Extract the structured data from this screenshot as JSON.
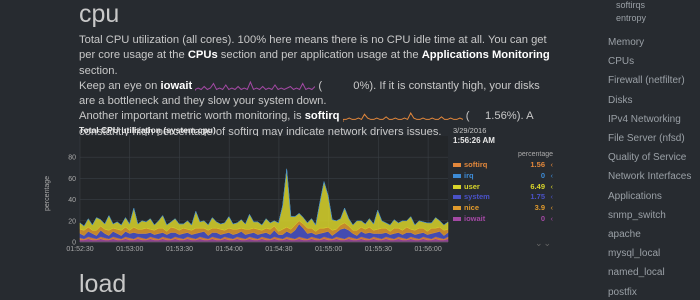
{
  "page": {
    "section_title": "cpu",
    "next_section_title": "load",
    "description": {
      "part1": "Total CPU utilization (all cores). 100% here means there is no CPU idle time at all. You can get per core usage at the ",
      "link_cpus": "CPUs",
      "part2": " section and per application usage at the ",
      "link_apps": "Applications Monitoring",
      "part3": " section.",
      "part4": "Keep an eye on ",
      "dim_iowait": "iowait",
      "iowait_value": "0%",
      "part5": ". If it is constantly high, your disks are a bottleneck and they slow your system down.",
      "part6": "Another important metric worth monitoring, is ",
      "dim_softirq": "softirq",
      "softirq_value": "1.56%",
      "part7": ". A constantly high percentage of softirq may indicate network drivers issues."
    }
  },
  "sidebar": {
    "top_items": [
      "softirqs",
      "entropy"
    ],
    "items": [
      "Memory",
      "CPUs",
      "Firewall (netfilter)",
      "Disks",
      "IPv4 Networking",
      "File Server (nfsd)",
      "Quality of Service",
      "Network Interfaces",
      "Applications",
      "snmp_switch",
      "apache",
      "mysql_local",
      "named_local",
      "postfix"
    ]
  },
  "chart": {
    "title": "Total CPU utilization (system.cpu)",
    "units_vertical": "percentage",
    "legend_units": "percentage",
    "date": "3/29/2016",
    "time": "1:56:26 AM",
    "dimensions": [
      {
        "name": "softirq",
        "value": "1.56",
        "color": "#e2873b"
      },
      {
        "name": "irq",
        "value": "0",
        "color": "#3d8bd6"
      },
      {
        "name": "user",
        "value": "6.49",
        "color": "#d8d42a"
      },
      {
        "name": "system",
        "value": "1.75",
        "color": "#4a52c8"
      },
      {
        "name": "nice",
        "value": "3.9",
        "color": "#e09a2d"
      },
      {
        "name": "iowait",
        "value": "0",
        "color": "#a349a4"
      }
    ],
    "resize_glyph": "⌄⌄"
  },
  "chart_data": {
    "type": "area",
    "title": "Total CPU utilization (system.cpu)",
    "ylabel": "percentage",
    "ylim": [
      0,
      100
    ],
    "yticks": [
      0,
      20,
      40,
      60,
      80
    ],
    "x_tick_labels": [
      "01:52:30",
      "01:53:00",
      "01:53:30",
      "01:54:00",
      "01:54:30",
      "01:55:00",
      "01:55:30",
      "01:56:00"
    ],
    "grid": true,
    "series": [
      {
        "name": "iowait",
        "color": "#a349a4",
        "values": [
          2,
          2,
          3,
          2,
          2,
          3,
          2,
          2,
          3,
          2,
          2,
          3,
          2,
          2,
          3,
          2,
          2,
          3,
          2,
          2,
          3,
          2,
          2,
          3,
          2,
          2,
          3,
          2,
          2,
          3,
          2,
          2,
          3,
          2,
          2,
          3,
          2,
          2,
          3,
          2,
          2,
          3,
          2,
          2,
          3,
          2,
          2,
          3,
          2,
          2,
          3,
          2,
          2,
          3,
          2,
          2,
          3,
          2,
          2,
          3,
          2,
          2,
          3,
          2,
          2,
          3,
          2,
          2,
          3,
          2,
          2,
          3,
          2,
          2,
          3,
          2,
          2,
          3,
          2,
          2,
          3,
          2,
          2,
          3,
          2,
          2,
          3,
          2,
          2,
          3
        ]
      },
      {
        "name": "softirq",
        "color": "#e2873b",
        "values": [
          2,
          1,
          2,
          2,
          1,
          2,
          2,
          1,
          2,
          2,
          1,
          2,
          2,
          1,
          2,
          2,
          1,
          2,
          2,
          1,
          2,
          2,
          1,
          2,
          2,
          1,
          2,
          2,
          1,
          2,
          2,
          1,
          2,
          2,
          1,
          2,
          2,
          1,
          2,
          2,
          1,
          2,
          2,
          1,
          2,
          2,
          1,
          2,
          2,
          1,
          2,
          2,
          1,
          2,
          2,
          1,
          2,
          2,
          1,
          2,
          2,
          1,
          2,
          2,
          1,
          2,
          2,
          1,
          2,
          2,
          1,
          2,
          2,
          1,
          2,
          2,
          1,
          2,
          2,
          1,
          2,
          2,
          1,
          2,
          2,
          1,
          2,
          2,
          1,
          2
        ]
      },
      {
        "name": "system",
        "color": "#4a52c8",
        "values": [
          4,
          3,
          5,
          4,
          3,
          6,
          4,
          3,
          5,
          4,
          3,
          5,
          4,
          6,
          3,
          4,
          5,
          4,
          3,
          5,
          4,
          3,
          6,
          4,
          3,
          5,
          4,
          3,
          5,
          4,
          6,
          3,
          4,
          5,
          4,
          3,
          5,
          4,
          3,
          6,
          4,
          3,
          5,
          4,
          3,
          5,
          4,
          6,
          3,
          4,
          5,
          4,
          8,
          12,
          9,
          5,
          4,
          3,
          5,
          4,
          6,
          3,
          4,
          8,
          10,
          6,
          4,
          3,
          5,
          4,
          6,
          3,
          4,
          5,
          4,
          3,
          5,
          4,
          3,
          6,
          4,
          3,
          5,
          4,
          3,
          5,
          4,
          6,
          3,
          4
        ]
      },
      {
        "name": "nice",
        "color": "#e09a2d",
        "values": [
          4,
          5,
          4,
          3,
          5,
          4,
          4,
          5,
          3,
          4,
          5,
          4,
          3,
          5,
          4,
          4,
          5,
          3,
          4,
          5,
          4,
          3,
          5,
          4,
          4,
          5,
          3,
          4,
          5,
          4,
          3,
          5,
          4,
          4,
          5,
          3,
          4,
          5,
          4,
          3,
          5,
          4,
          4,
          5,
          3,
          4,
          5,
          4,
          3,
          5,
          4,
          4,
          5,
          3,
          4,
          5,
          4,
          3,
          5,
          4,
          4,
          5,
          3,
          4,
          5,
          4,
          3,
          5,
          4,
          4,
          5,
          3,
          4,
          5,
          4,
          3,
          5,
          4,
          4,
          5,
          3,
          4,
          5,
          4,
          3,
          5,
          4,
          4,
          5,
          3
        ]
      },
      {
        "name": "user",
        "color": "#d8d42a",
        "values": [
          6,
          4,
          8,
          5,
          12,
          6,
          5,
          14,
          4,
          7,
          5,
          9,
          6,
          18,
          5,
          8,
          6,
          10,
          5,
          7,
          12,
          6,
          5,
          9,
          6,
          4,
          8,
          5,
          16,
          6,
          7,
          5,
          10,
          6,
          5,
          7,
          11,
          5,
          6,
          8,
          5,
          14,
          6,
          7,
          5,
          9,
          6,
          5,
          8,
          22,
          55,
          12,
          8,
          7,
          6,
          5,
          9,
          6,
          24,
          44,
          30,
          10,
          8,
          6,
          14,
          7,
          5,
          9,
          6,
          5,
          8,
          6,
          18,
          7,
          5,
          6,
          8,
          5,
          9,
          6,
          12,
          5,
          7,
          6,
          8,
          5,
          10,
          6,
          5,
          7
        ]
      },
      {
        "name": "irq",
        "color": "#3d8bd6",
        "values": [
          0,
          0,
          0,
          0,
          0,
          0,
          0,
          0,
          0,
          0,
          0,
          0,
          0,
          0,
          0,
          0,
          0,
          0,
          0,
          0,
          0,
          0,
          0,
          0,
          0,
          0,
          0,
          0,
          0,
          0,
          0,
          0,
          0,
          0,
          0,
          0,
          0,
          0,
          0,
          0,
          0,
          0,
          0,
          0,
          0,
          0,
          0,
          0,
          0,
          0,
          0,
          0,
          0,
          0,
          0,
          0,
          0,
          0,
          0,
          0,
          0,
          0,
          0,
          0,
          0,
          0,
          0,
          0,
          0,
          0,
          0,
          0,
          0,
          0,
          0,
          0,
          0,
          0,
          0,
          0,
          0,
          0,
          0,
          0,
          0,
          0,
          0,
          0,
          0,
          0
        ]
      }
    ]
  },
  "sparklines": {
    "iowait": [
      1,
      2,
      1,
      3,
      1,
      2,
      5,
      1,
      2,
      1,
      4,
      1,
      2,
      1,
      3,
      1,
      2,
      1,
      6,
      1,
      2,
      1,
      3,
      1,
      2,
      1,
      4,
      1,
      2,
      1,
      2,
      3,
      1,
      2,
      1,
      5,
      1,
      2,
      1,
      3
    ],
    "softirq": [
      2,
      2,
      3,
      2,
      2,
      3,
      2,
      6,
      3,
      2,
      2,
      3,
      2,
      2,
      4,
      2,
      2,
      3,
      2,
      2,
      3,
      2,
      7,
      3,
      2,
      2,
      3,
      2,
      2,
      3,
      2,
      2,
      4,
      2,
      2,
      3,
      2,
      2,
      3,
      2
    ]
  }
}
